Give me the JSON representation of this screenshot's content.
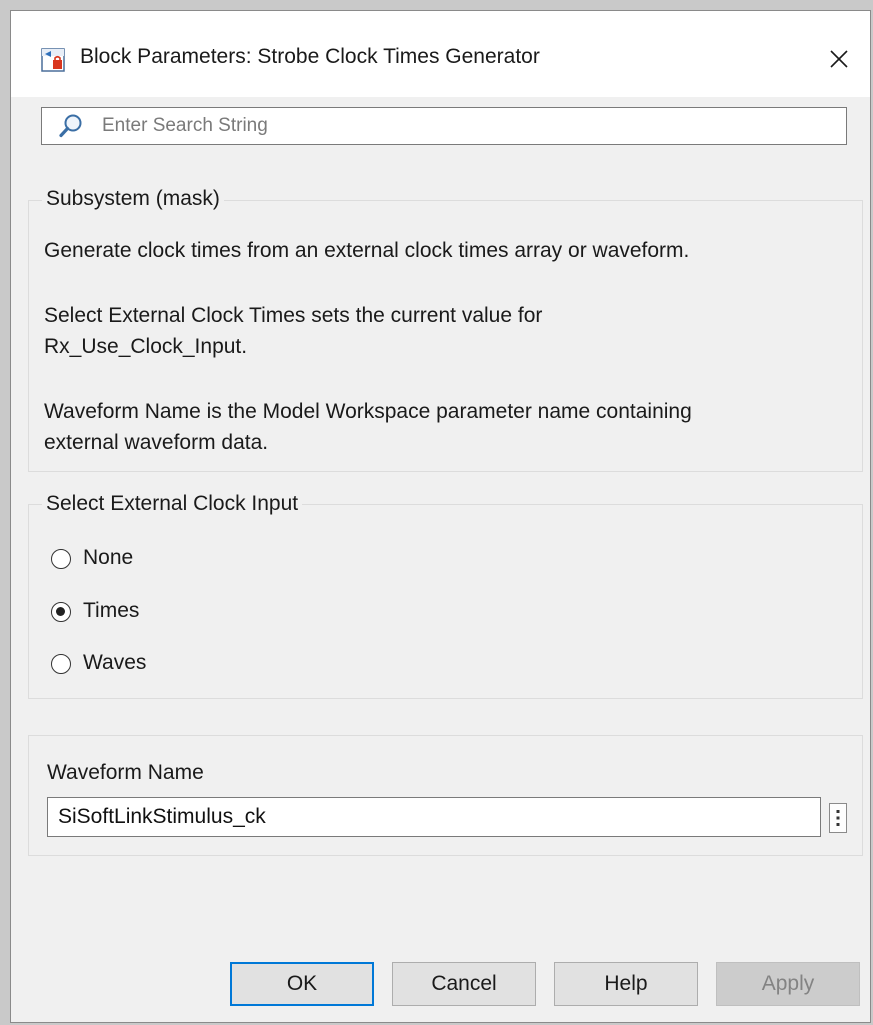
{
  "window": {
    "title": "Block Parameters: Strobe Clock Times Generator",
    "icon": "simulink-block-icon",
    "close_icon": "close-icon"
  },
  "search": {
    "placeholder": "Enter Search String",
    "value": ""
  },
  "description_group": {
    "legend": "Subsystem (mask)",
    "lines": [
      "Generate clock times from an external clock times array or waveform.",
      "Select External Clock Times sets the current value for",
      "Rx_Use_Clock_Input.",
      "Waveform Name is the Model Workspace parameter name containing",
      "external waveform data."
    ]
  },
  "clock_input_group": {
    "legend": "Select External Clock Input",
    "options": [
      {
        "label": "None",
        "selected": false
      },
      {
        "label": "Times",
        "selected": true
      },
      {
        "label": "Waves",
        "selected": false
      }
    ]
  },
  "waveform": {
    "label": "Waveform Name",
    "value": "SiSoftLinkStimulus_ck",
    "more_icon": "vertical-ellipsis-icon"
  },
  "buttons": {
    "ok": "OK",
    "cancel": "Cancel",
    "help": "Help",
    "apply": "Apply"
  },
  "colors": {
    "accent": "#0078d7",
    "dialog_bg": "#f0f0f0",
    "titlebar_bg": "#ffffff"
  }
}
